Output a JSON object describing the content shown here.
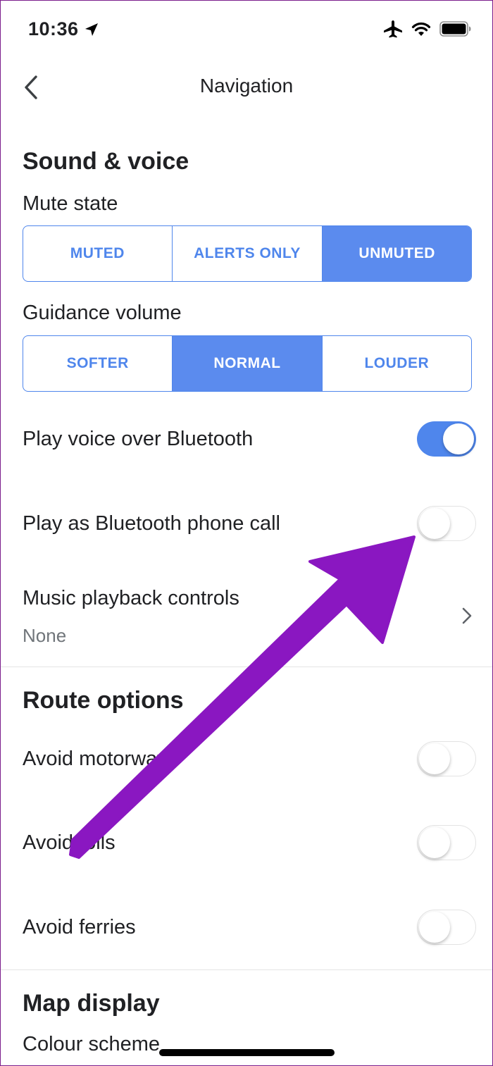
{
  "status_bar": {
    "time": "10:36",
    "icons": [
      "location-arrow-icon",
      "airplane-icon",
      "wifi-icon",
      "battery-icon"
    ]
  },
  "nav": {
    "title": "Navigation",
    "back_icon": "chevron-left-icon"
  },
  "sound_voice": {
    "heading": "Sound & voice",
    "mute_state": {
      "label": "Mute state",
      "options": [
        "MUTED",
        "ALERTS ONLY",
        "UNMUTED"
      ],
      "selected": "UNMUTED"
    },
    "guidance_volume": {
      "label": "Guidance volume",
      "options": [
        "SOFTER",
        "NORMAL",
        "LOUDER"
      ],
      "selected": "NORMAL"
    },
    "play_voice_bluetooth": {
      "label": "Play voice over Bluetooth",
      "on": true
    },
    "play_as_phone_call": {
      "label": "Play as Bluetooth phone call",
      "on": false
    },
    "music_playback": {
      "label": "Music playback controls",
      "value": "None"
    }
  },
  "route_options": {
    "heading": "Route options",
    "avoid_motorways": {
      "label": "Avoid motorways",
      "on": false
    },
    "avoid_tolls": {
      "label": "Avoid tolls",
      "on": false
    },
    "avoid_ferries": {
      "label": "Avoid ferries",
      "on": false
    }
  },
  "map_display": {
    "heading": "Map display",
    "colour_scheme": {
      "label": "Colour scheme"
    }
  },
  "colors": {
    "accent": "#4f86ec",
    "arrow": "#8a17c1"
  }
}
